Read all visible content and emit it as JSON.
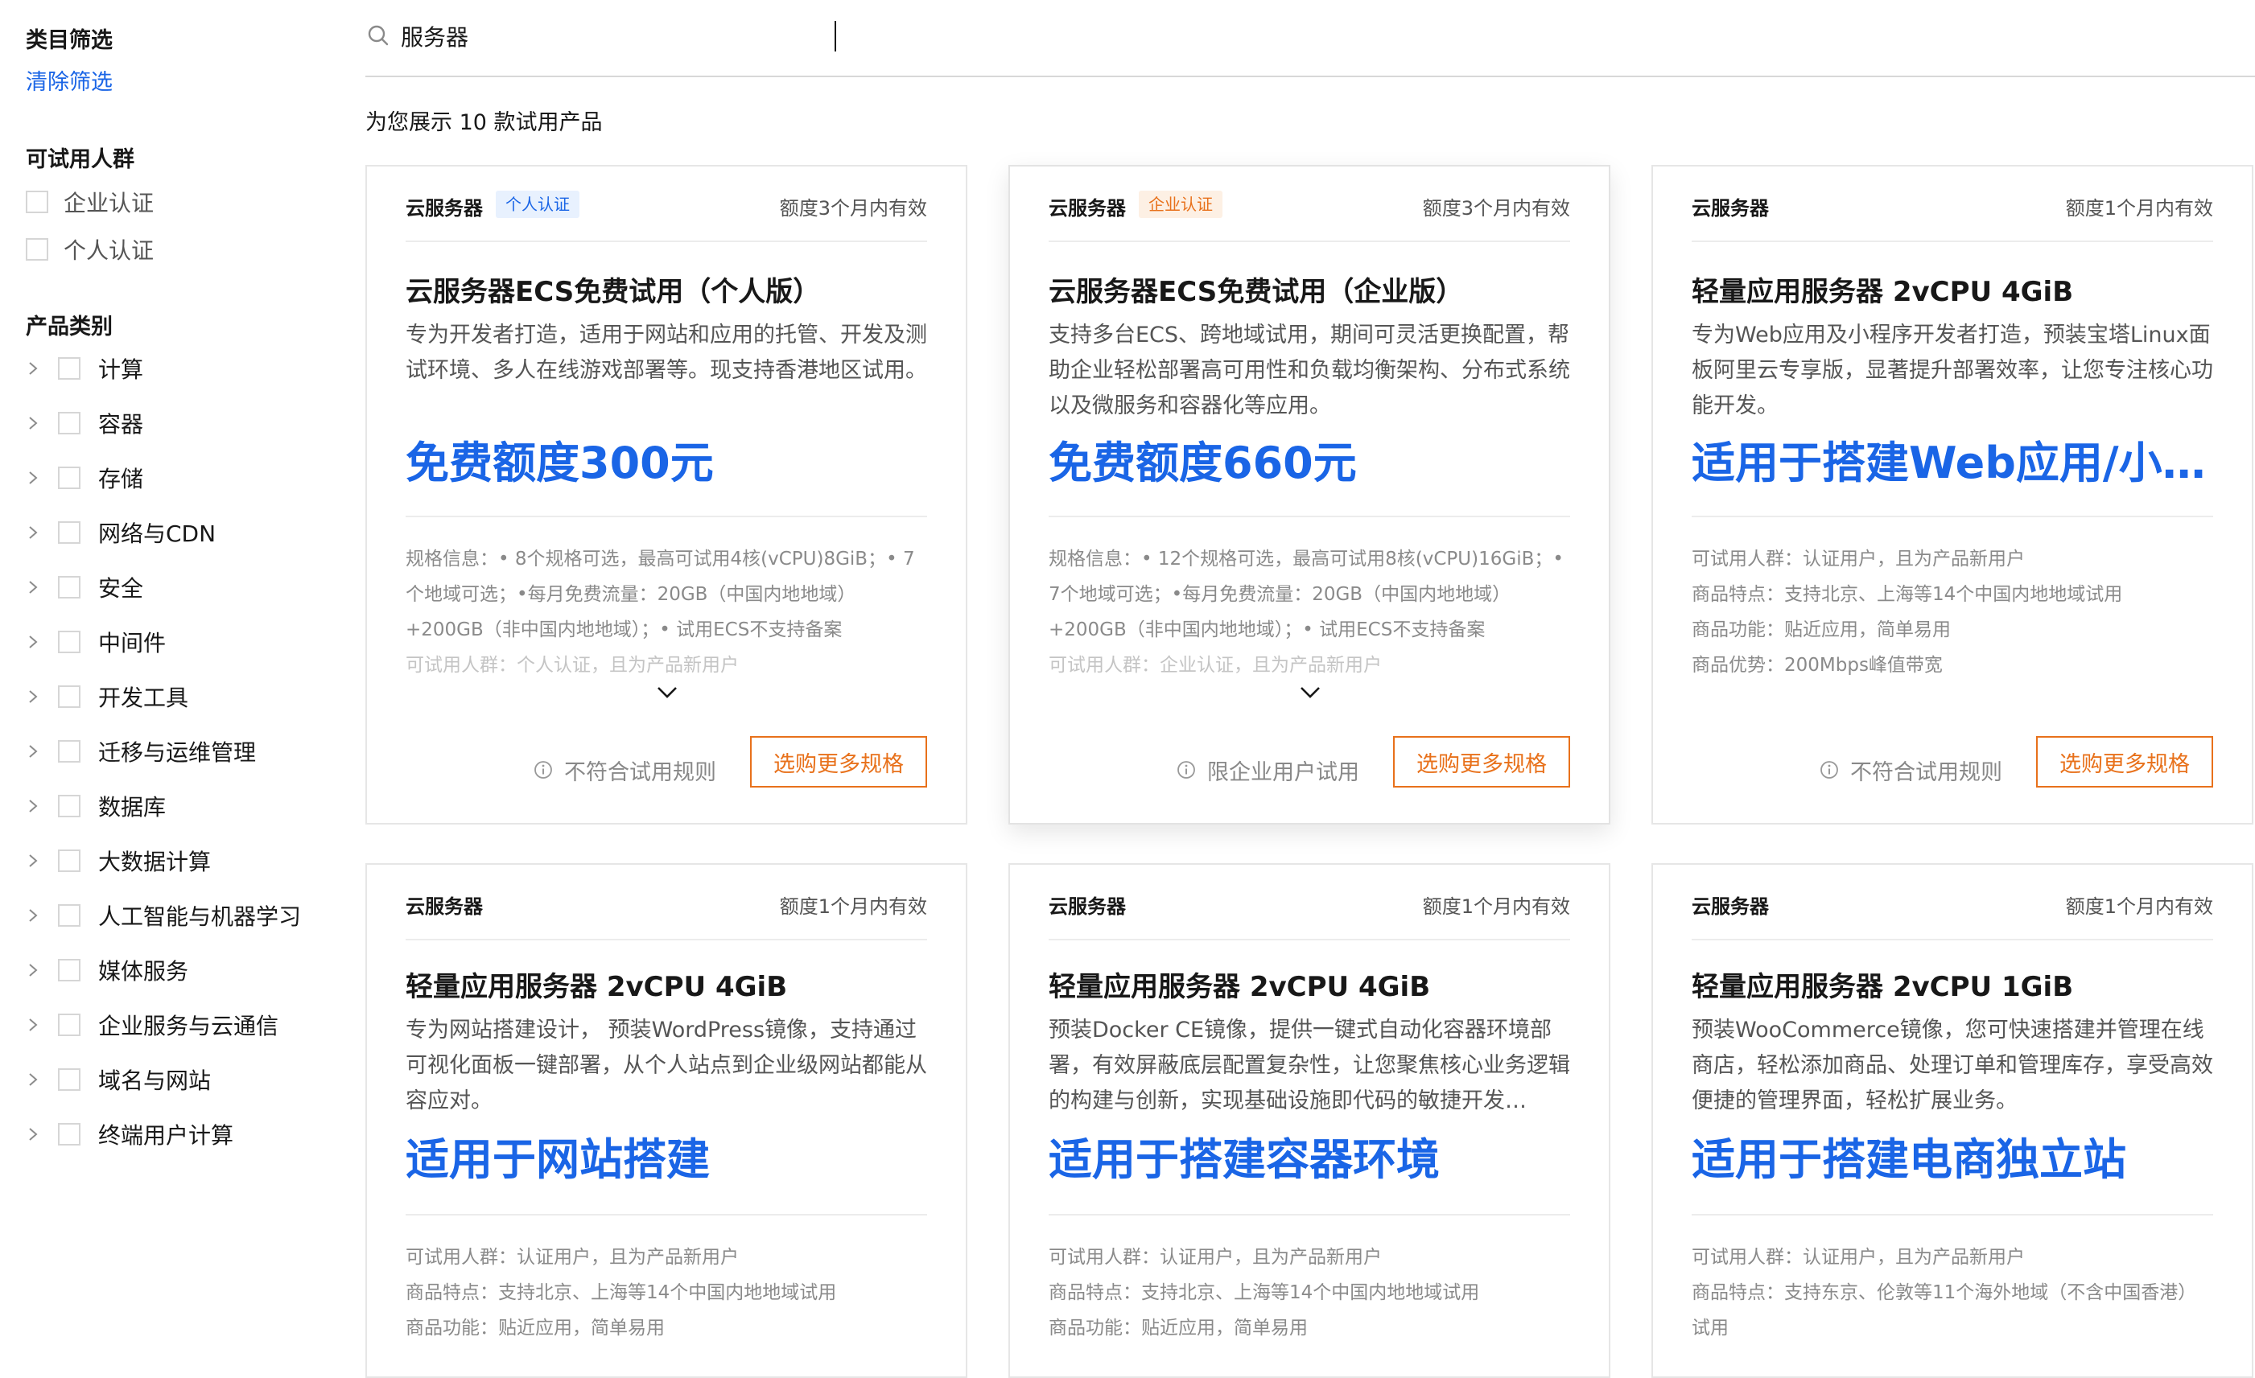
{
  "sidebar": {
    "category_filter": "类目筛选",
    "clear_filter": "清除筛选",
    "audience": {
      "heading": "可试用人群",
      "options": [
        "企业认证",
        "个人认证"
      ]
    },
    "product_types": {
      "heading": "产品类别",
      "items": [
        "计算",
        "容器",
        "存储",
        "网络与CDN",
        "安全",
        "中间件",
        "开发工具",
        "迁移与运维管理",
        "数据库",
        "大数据计算",
        "人工智能与机器学习",
        "媒体服务",
        "企业服务与云通信",
        "域名与网站",
        "终端用户计算"
      ]
    }
  },
  "search": {
    "value": "服务器",
    "icon": "search-icon"
  },
  "result_summary": "为您展示 10 款试用产品",
  "cards": [
    {
      "category": "云服务器",
      "badge": "个人认证",
      "validity": "额度3个月内有效",
      "title": "云服务器ECS免费试用（个人版）",
      "desc": "专为开发者打造，适用于网站和应用的托管、开发及测试环境、多人在线游戏部署等。现支持香港地区试用。",
      "price": "免费额度300元",
      "specs": [
        "规格信息：• 8个规格可选，最高可试用4核(vCPU)8GiB；• 7",
        "个地域可选；•每月免费流量：20GB（中国内地地域）",
        "+200GB（非中国内地地域）；• 试用ECS不支持备案",
        "可试用人群：个人认证，且为产品新用户"
      ],
      "rule_note": "不符合试用规则",
      "button": "选购更多规格"
    },
    {
      "category": "云服务器",
      "badge": "企业认证",
      "validity": "额度3个月内有效",
      "title": "云服务器ECS免费试用（企业版）",
      "desc": "支持多台ECS、跨地域试用，期间可灵活更换配置，帮助企业轻松部署高可用性和负载均衡架构、分布式系统以及微服务和容器化等应用。",
      "price": "免费额度660元",
      "specs": [
        "规格信息：• 12个规格可选，最高可试用8核(vCPU)16GiB；•",
        "7个地域可选；•每月免费流量：20GB（中国内地地域）",
        "+200GB（非中国内地地域）；• 试用ECS不支持备案",
        "可试用人群：企业认证，且为产品新用户"
      ],
      "rule_note": "限企业用户试用",
      "button": "选购更多规格"
    },
    {
      "category": "云服务器",
      "badge": "",
      "validity": "额度1个月内有效",
      "title": "轻量应用服务器 2vCPU 4GiB",
      "desc": "专为Web应用及小程序开发者打造，预装宝塔Linux面板阿里云专享版，显著提升部署效率，让您专注核心功能开发。",
      "price": "适用于搭建Web应用/小程序",
      "specs": [
        "可试用人群：认证用户，且为产品新用户",
        "商品特点：支持北京、上海等14个中国内地地域试用",
        "商品功能：贴近应用，简单易用",
        "商品优势：200Mbps峰值带宽"
      ],
      "rule_note": "不符合试用规则",
      "button": "选购更多规格"
    },
    {
      "category": "云服务器",
      "badge": "",
      "validity": "额度1个月内有效",
      "title": "轻量应用服务器 2vCPU 4GiB",
      "desc": "专为网站搭建设计， 预装WordPress镜像，支持通过可视化面板一键部署，从个人站点到企业级网站都能从容应对。",
      "price": "适用于网站搭建",
      "specs": [
        "可试用人群：认证用户，且为产品新用户",
        "商品特点：支持北京、上海等14个中国内地地域试用",
        "商品功能：贴近应用，简单易用"
      ]
    },
    {
      "category": "云服务器",
      "badge": "",
      "validity": "额度1个月内有效",
      "title": "轻量应用服务器 2vCPU 4GiB",
      "desc": "预装Docker CE镜像，提供一键式自动化容器环境部署，有效屏蔽底层配置复杂性，让您聚焦核心业务逻辑的构建与创新，实现基础设施即代码的敏捷开发…",
      "price": "适用于搭建容器环境",
      "specs": [
        "可试用人群：认证用户，且为产品新用户",
        "商品特点：支持北京、上海等14个中国内地地域试用",
        "商品功能：贴近应用，简单易用"
      ]
    },
    {
      "category": "云服务器",
      "badge": "",
      "validity": "额度1个月内有效",
      "title": "轻量应用服务器 2vCPU 1GiB",
      "desc": "预装WooCommerce镜像，您可快速搭建并管理在线商店，轻松添加商品、处理订单和管理库存，享受高效便捷的管理界面，轻松扩展业务。",
      "price": "适用于搭建电商独立站",
      "specs": [
        "可试用人群：认证用户，且为产品新用户",
        "商品特点：支持东京、伦敦等11个海外地域（不含中国香港）",
        "试用"
      ]
    }
  ],
  "colors": {
    "accent_blue": "#1a65e6",
    "accent_orange": "#e8711b",
    "badge_blue_bg": "#e8f1fe",
    "badge_orange_bg": "#fdf0e4"
  }
}
